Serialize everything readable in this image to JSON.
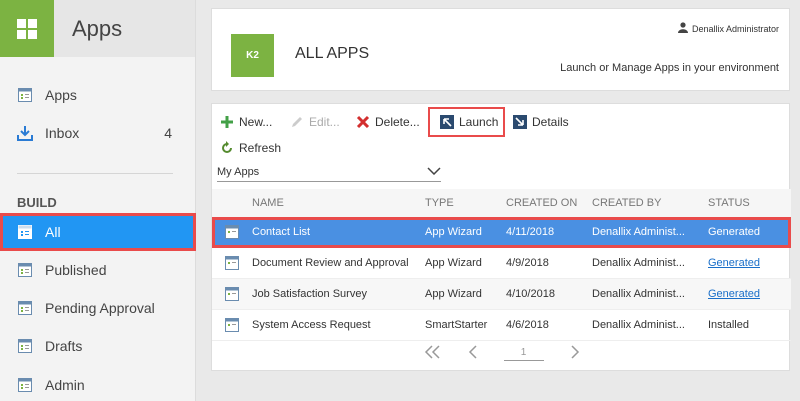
{
  "sidebar": {
    "title": "Apps",
    "items": [
      {
        "label": "Apps"
      },
      {
        "label": "Inbox",
        "count": "4"
      }
    ],
    "section": "BUILD",
    "build_items": [
      {
        "label": "All"
      },
      {
        "label": "Published"
      },
      {
        "label": "Pending Approval"
      },
      {
        "label": "Drafts"
      },
      {
        "label": "Admin"
      }
    ]
  },
  "header": {
    "logo": "K2",
    "title": "ALL APPS",
    "user": "Denallix Administrator",
    "subtitle": "Launch or Manage Apps in your environment"
  },
  "toolbar": {
    "new": "New...",
    "edit": "Edit...",
    "delete": "Delete...",
    "launch": "Launch",
    "details": "Details",
    "refresh": "Refresh"
  },
  "filter": {
    "selected": "My Apps"
  },
  "table": {
    "columns": [
      "NAME",
      "TYPE",
      "CREATED ON",
      "CREATED BY",
      "STATUS"
    ],
    "rows": [
      {
        "name": "Contact List",
        "type": "App Wizard",
        "created_on": "4/11/2018",
        "created_by": "Denallix Administ...",
        "status": "Generated"
      },
      {
        "name": "Document Review and Approval",
        "type": "App Wizard",
        "created_on": "4/9/2018",
        "created_by": "Denallix Administ...",
        "status": "Generated"
      },
      {
        "name": "Job Satisfaction Survey",
        "type": "App Wizard",
        "created_on": "4/10/2018",
        "created_by": "Denallix Administ...",
        "status": "Generated"
      },
      {
        "name": "System Access Request",
        "type": "SmartStarter",
        "created_on": "4/6/2018",
        "created_by": "Denallix Administ...",
        "status": "Installed"
      }
    ]
  },
  "pager": {
    "page": "1"
  },
  "colors": {
    "accent": "#2196f3",
    "brand": "#7cb342",
    "highlight": "#e94b4b"
  }
}
